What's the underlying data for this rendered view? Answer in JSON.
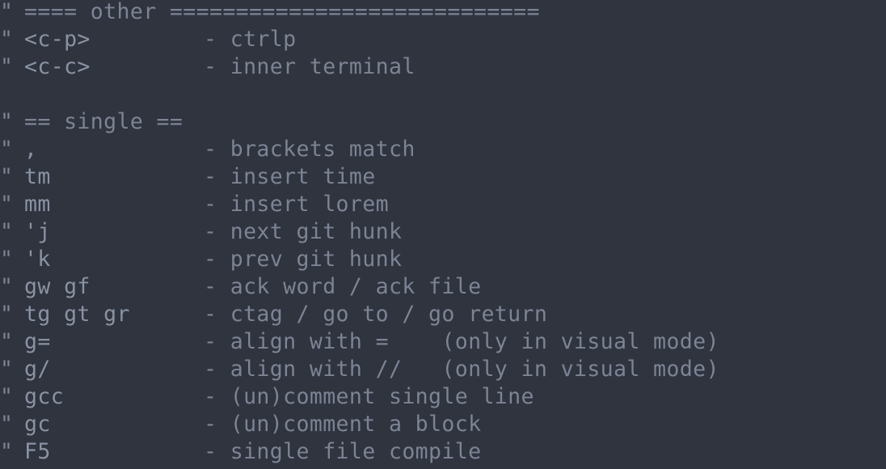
{
  "comment_marker": "\"",
  "lines": [
    {
      "type": "heading",
      "text": "==== other ============================"
    },
    {
      "type": "entry",
      "key": "<c-p>",
      "desc": "- ctrlp"
    },
    {
      "type": "entry",
      "key": "<c-c>",
      "desc": "- inner terminal"
    },
    {
      "type": "blank"
    },
    {
      "type": "heading",
      "text": "== single =="
    },
    {
      "type": "entry",
      "key": ",",
      "desc": "- brackets match"
    },
    {
      "type": "entry",
      "key": "tm",
      "desc": "- insert time"
    },
    {
      "type": "entry",
      "key": "mm",
      "desc": "- insert lorem"
    },
    {
      "type": "entry",
      "key": "'j",
      "desc": "- next git hunk"
    },
    {
      "type": "entry",
      "key": "'k",
      "desc": "- prev git hunk"
    },
    {
      "type": "entry",
      "key": "gw gf",
      "desc": "- ack word / ack file"
    },
    {
      "type": "entry",
      "key": "tg gt gr",
      "desc": "- ctag / go to / go return"
    },
    {
      "type": "entry",
      "key": "g=",
      "desc": "- align with =    (only in visual mode)"
    },
    {
      "type": "entry",
      "key": "g/",
      "desc": "- align with //   (only in visual mode)"
    },
    {
      "type": "entry",
      "key": "gcc",
      "desc": "- (un)comment single line"
    },
    {
      "type": "entry",
      "key": "gc",
      "desc": "- (un)comment a block"
    },
    {
      "type": "entry",
      "key": "F5",
      "desc": "- single file compile"
    }
  ]
}
